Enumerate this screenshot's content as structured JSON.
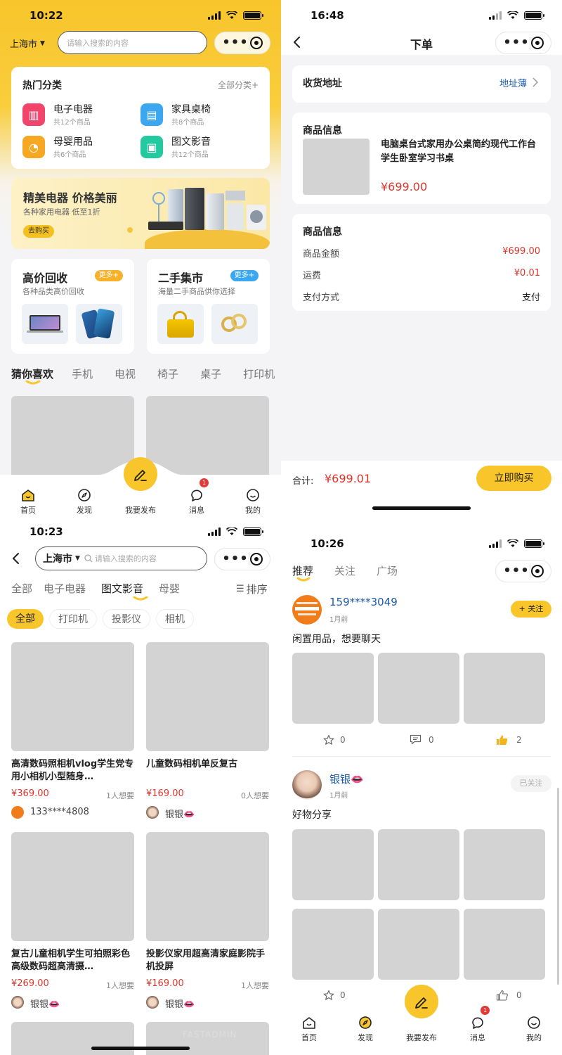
{
  "colors": {
    "accent": "#f8c52b",
    "price": "#e0352b",
    "link": "#1b5aa6"
  },
  "home": {
    "time": "10:22",
    "city": "上海市",
    "search_placeholder": "请输入搜索的内容",
    "hot_title": "热门分类",
    "all_categories": "全部分类+",
    "categories": [
      {
        "name": "电子电器",
        "count": "共12个商品",
        "icon": "electronics-icon",
        "color": "#f3456c"
      },
      {
        "name": "家具桌椅",
        "count": "共8个商品",
        "icon": "furniture-icon",
        "color": "#3aa7f0"
      },
      {
        "name": "母婴用品",
        "count": "共6个商品",
        "icon": "baby-stroller-icon",
        "color": "#f7a823"
      },
      {
        "name": "图文影音",
        "count": "共12个商品",
        "icon": "media-icon",
        "color": "#24c9a0"
      }
    ],
    "banner": {
      "title": "精美电器 价格美丽",
      "sub": "各种家用电器 低至1折",
      "button": "去购买"
    },
    "recycle": {
      "title": "高价回收",
      "more": "更多+",
      "sub": "各种品类高价回收"
    },
    "market": {
      "title": "二手集市",
      "more": "更多+",
      "sub": "海量二手商品供你选择"
    },
    "feed_tabs": [
      "猜你喜欢",
      "手机",
      "电视",
      "椅子",
      "桌子",
      "打印机"
    ]
  },
  "tabbar": {
    "home": "首页",
    "discover": "发现",
    "publish": "我要发布",
    "messages": "消息",
    "mine": "我的",
    "badge": "1"
  },
  "order": {
    "time": "16:48",
    "title": "下单",
    "address_label": "收货地址",
    "address_link": "地址薄",
    "goods_title": "商品信息",
    "product_name": "电脑桌台式家用办公桌简约现代工作台学生卧室学习书桌",
    "product_price": "¥699.00",
    "summary_title": "商品信息",
    "rows": [
      {
        "label": "商品金额",
        "value": "¥699.00",
        "red": true
      },
      {
        "label": "运费",
        "value": "¥0.01",
        "red": true
      },
      {
        "label": "支付方式",
        "value": "支付",
        "red": false
      }
    ],
    "total_label": "合计:",
    "total_value": "¥699.01",
    "buy_button": "立即购买"
  },
  "category": {
    "time": "10:23",
    "city": "上海市",
    "search_placeholder": "请输入搜索的内容",
    "tabs": [
      "全部",
      "电子电器",
      "图文影音",
      "母婴"
    ],
    "active_tab": 2,
    "sort": "排序",
    "chips": [
      "全部",
      "打印机",
      "投影仪",
      "相机"
    ],
    "products": [
      {
        "title": "高清数码照相机vlog学生党专用小相机小型随身…",
        "price": "¥369.00",
        "want": "1人想要",
        "seller": "133****4808"
      },
      {
        "title": "儿童数码相机单反复古",
        "price": "¥169.00",
        "want": "0人想要",
        "seller": "银银👄"
      },
      {
        "title": "复古儿童相机学生可拍照彩色高级数码超高清摄…",
        "price": "¥269.00",
        "want": "1人想要",
        "seller": "银银👄"
      },
      {
        "title": "投影仪家用超高清家庭影院手机投屏",
        "price": "¥169.00",
        "want": "1人想要",
        "seller": "银银👄"
      }
    ],
    "watermark": "FASTADMIN"
  },
  "discover": {
    "time": "10:26",
    "tabs": [
      "推荐",
      "关注",
      "广场"
    ],
    "posts": [
      {
        "user": "159****3049",
        "time": "1月前",
        "follow": "+ 关注",
        "text": "闲置用品，想要聊天",
        "stars": "0",
        "comments": "0",
        "likes": "2"
      },
      {
        "user": "银银👄",
        "time": "1月前",
        "follow": "已关注",
        "text": "好物分享",
        "stars": "0",
        "likes": "0"
      }
    ]
  }
}
